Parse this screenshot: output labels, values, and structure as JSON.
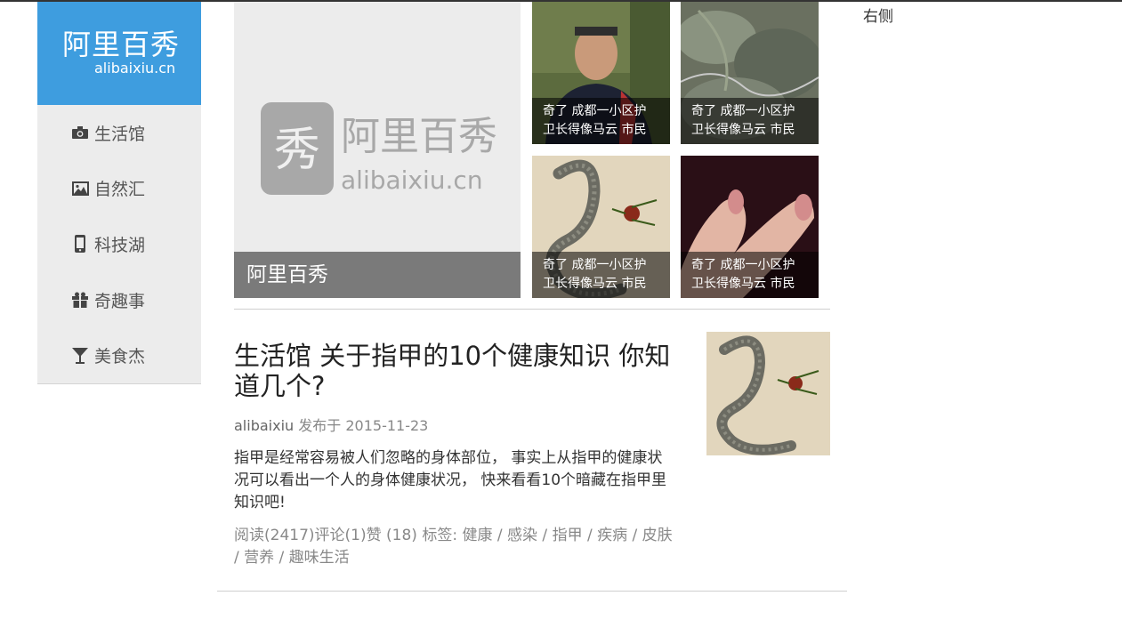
{
  "logo": {
    "cn": "阿里百秀",
    "en": "alibaixiu.cn"
  },
  "sidebar": {
    "items": [
      {
        "label": "生活馆",
        "icon": "camera-icon"
      },
      {
        "label": "自然汇",
        "icon": "picture-icon"
      },
      {
        "label": "科技湖",
        "icon": "phone-icon"
      },
      {
        "label": "奇趣事",
        "icon": "gift-icon"
      },
      {
        "label": "美食杰",
        "icon": "cocktail-icon"
      }
    ]
  },
  "featured": {
    "main": {
      "caption": "阿里百秀",
      "watermark_cn": "阿里百秀",
      "watermark_en": "alibaixiu.cn",
      "watermark_char": "秀"
    },
    "thumbs": [
      {
        "line1": "奇了 成都一小区护",
        "line2": "卫长得像马云 市民"
      },
      {
        "line1": "奇了 成都一小区护",
        "line2": "卫长得像马云 市民"
      },
      {
        "line1": "奇了 成都一小区护",
        "line2": "卫长得像马云 市民"
      },
      {
        "line1": "奇了 成都一小区护",
        "line2": "卫长得像马云 市民"
      }
    ]
  },
  "article": {
    "title": "生活馆 关于指甲的10个健康知识 你知道几个?",
    "author": "alibaixiu",
    "published_label": "发布于",
    "date": "2015-11-23",
    "excerpt": "指甲是经常容易被人们忽略的身体部位， 事实上从指甲的健康状况可以看出一个人的身体健康状况， 快来看看10个暗藏在指甲里知识吧!",
    "stats": {
      "read": "阅读(2417)",
      "comment": "评论(1)",
      "like": "赞 (18)",
      "tags_label": "标签:",
      "tags": [
        "健康",
        "感染",
        "指甲",
        "疾病",
        "皮肤",
        "营养",
        "趣味生活"
      ]
    }
  },
  "right": {
    "label": "右侧"
  },
  "colors": {
    "brand": "#3e9ddf",
    "sidebar_bg": "#ececec",
    "caption_bg": "#7a7a7a"
  }
}
